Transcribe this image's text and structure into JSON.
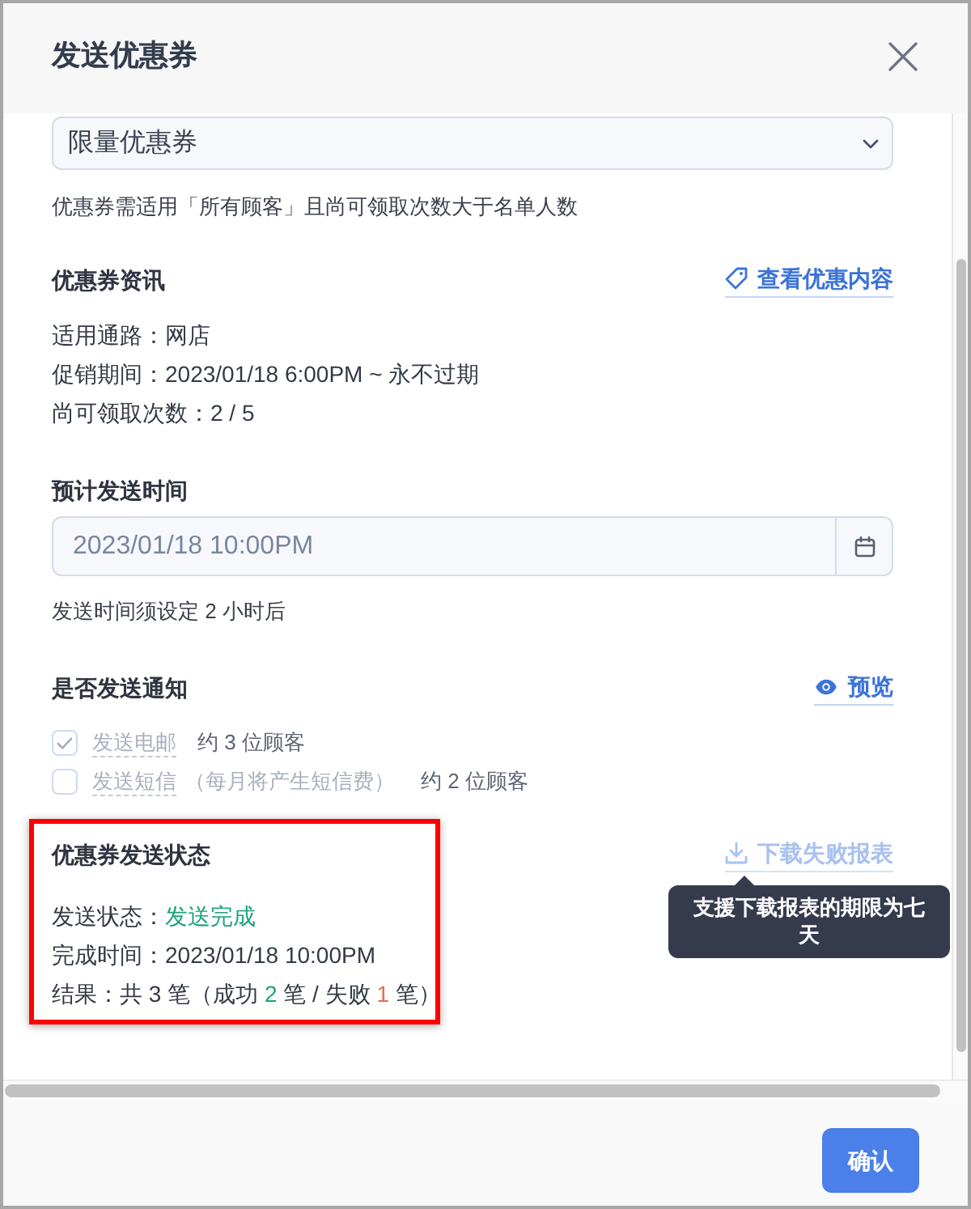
{
  "dialog": {
    "title": "发送优惠券"
  },
  "coupon": {
    "select_value": "限量优惠券",
    "hint": "优惠券需适用「所有顾客」且尚可领取次数大于名单人数"
  },
  "coupon_info": {
    "title": "优惠券资讯",
    "link": "查看优惠内容",
    "lines": [
      "适用通路：网店",
      "促销期间：2023/01/18 6:00PM ~ 永不过期",
      "尚可领取次数：2 / 5"
    ]
  },
  "schedule": {
    "title": "预计发送时间",
    "value": "2023/01/18 10:00PM",
    "hint": "发送时间须设定 2 小时后"
  },
  "notification": {
    "title": "是否发送通知",
    "link": "预览",
    "options": [
      {
        "label": "发送电邮",
        "count": "约 3 位顾客",
        "checked": true,
        "disabled": true
      },
      {
        "label": "发送短信",
        "note": "（每月将产生短信费）",
        "count": "约 2 位顾客",
        "checked": false,
        "disabled": true
      }
    ]
  },
  "send_status": {
    "title": "优惠券发送状态",
    "highlighted": true,
    "download_link": {
      "label": "下载失败报表",
      "disabled": true
    },
    "tooltip": "支援下载报表的期限为七天",
    "lines": [
      {
        "parts": [
          {
            "text": "发送状态："
          },
          {
            "text": "发送完成",
            "color": "#1ba37b"
          }
        ]
      },
      {
        "parts": [
          {
            "text": "完成时间：2023/01/18 10:00PM"
          }
        ]
      },
      {
        "parts": [
          {
            "text": "结果：共 3 笔（成功 "
          },
          {
            "text": "2",
            "color": "#1ba37b"
          },
          {
            "text": " 笔 / 失败 "
          },
          {
            "text": "1",
            "color": "#ec6a4c"
          },
          {
            "text": " 笔）"
          }
        ]
      }
    ]
  },
  "footer": {
    "confirm": "确认"
  }
}
